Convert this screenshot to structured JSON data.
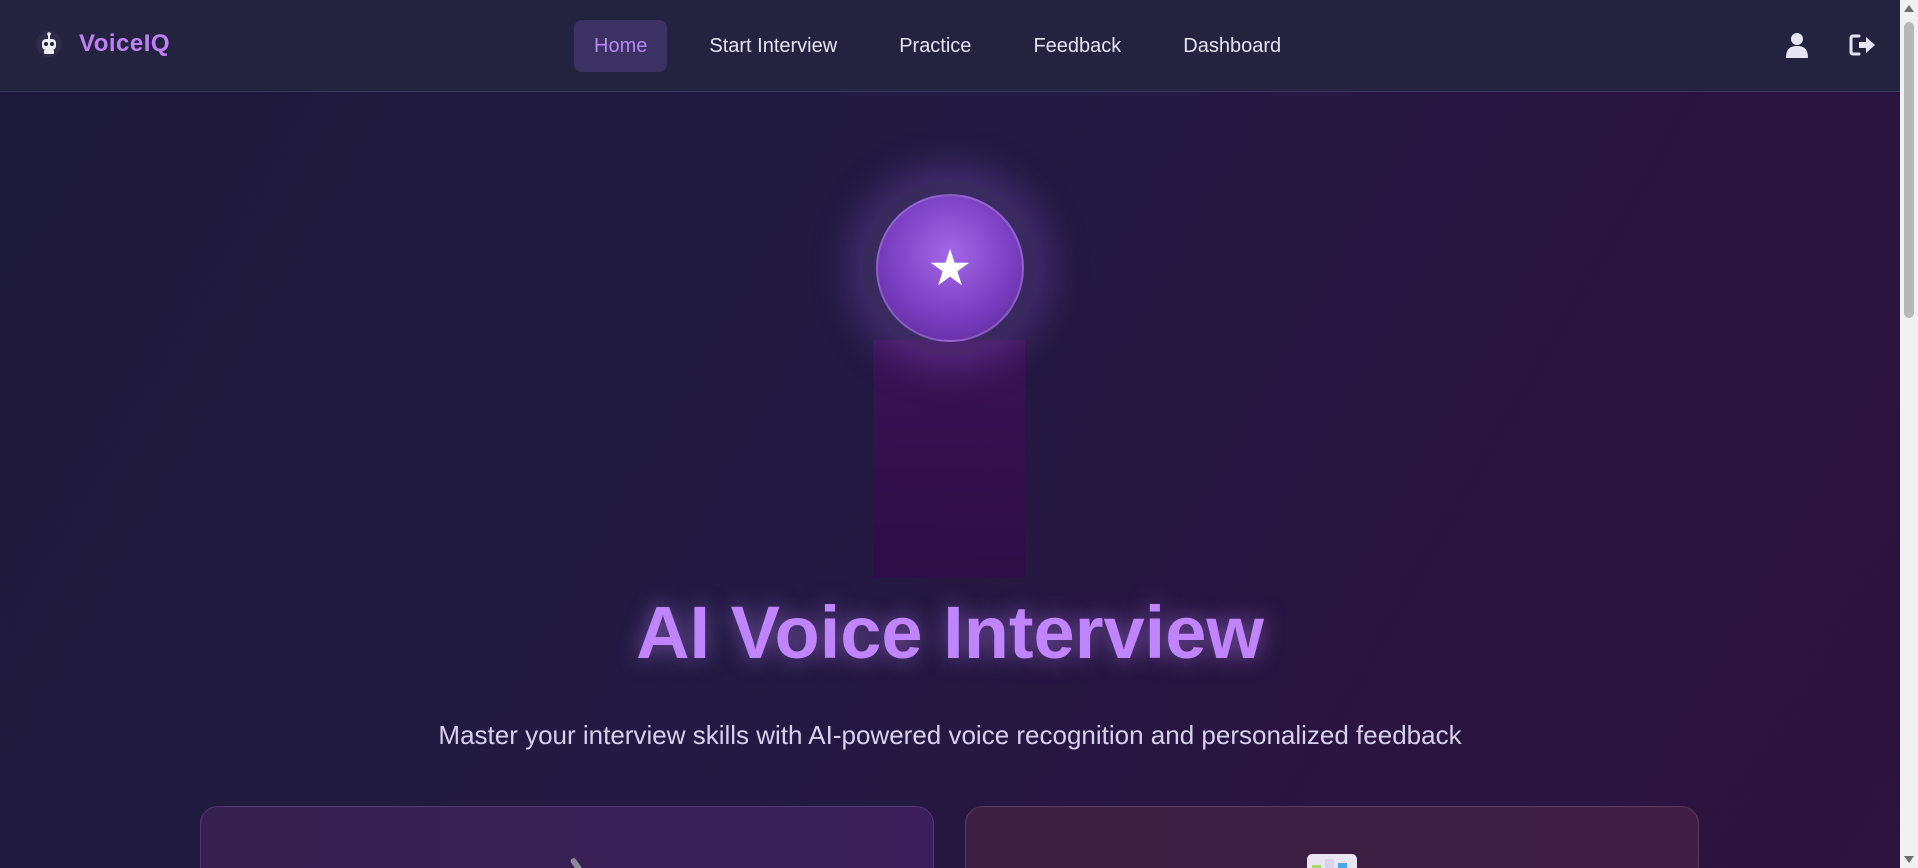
{
  "brand": {
    "name": "VoiceIQ",
    "icon": "robot-icon"
  },
  "nav": {
    "items": [
      {
        "label": "Home",
        "active": true
      },
      {
        "label": "Start Interview",
        "active": false
      },
      {
        "label": "Practice",
        "active": false
      },
      {
        "label": "Feedback",
        "active": false
      },
      {
        "label": "Dashboard",
        "active": false
      }
    ],
    "icons": [
      "user-icon",
      "logout-icon"
    ]
  },
  "hero": {
    "icon": "star-icon",
    "title": "AI Voice Interview",
    "subtitle": "Master your interview skills with AI-powered voice recognition and personalized feedback"
  },
  "cards": [
    {
      "icon": "microphone-icon"
    },
    {
      "icon": "dashboard-icon"
    }
  ],
  "colors": {
    "accent": "#c084fc",
    "nav_background": "#232340",
    "active_nav_background": "#3b3162",
    "page_background": "#1e1a3a"
  }
}
